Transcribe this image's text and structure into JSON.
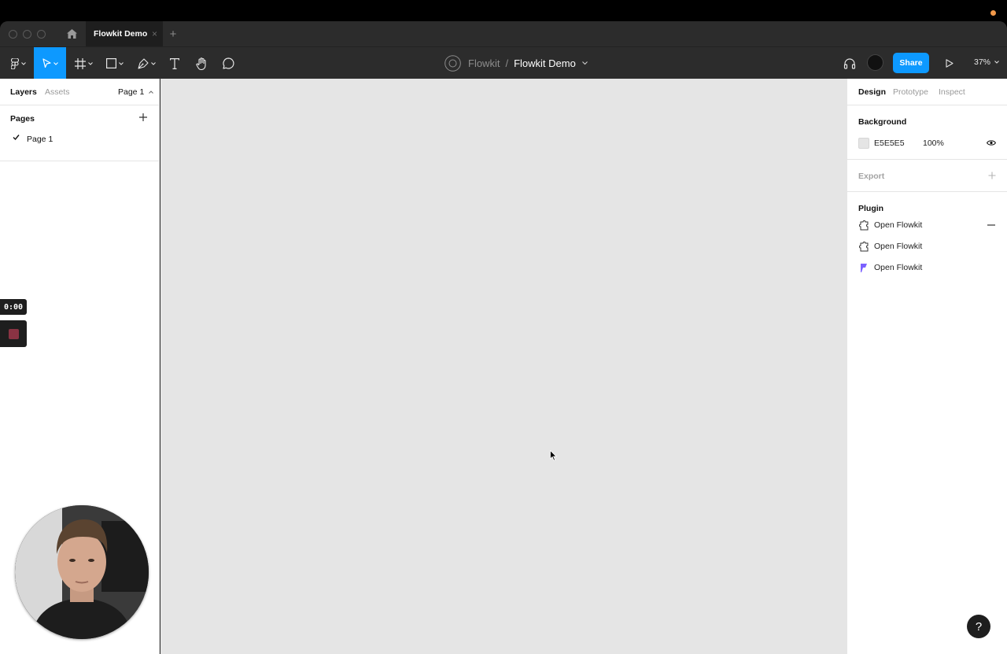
{
  "window": {
    "tab_title": "Flowkit Demo",
    "new_tab": "+",
    "tab_close": "×"
  },
  "toolbar": {
    "team": "Flowkit",
    "separator": "/",
    "file_name": "Flowkit Demo",
    "share_label": "Share",
    "zoom": "37%"
  },
  "left_panel": {
    "tab_layers": "Layers",
    "tab_assets": "Assets",
    "page_selector": "Page 1",
    "pages_label": "Pages",
    "pages": [
      {
        "label": "Page 1",
        "selected": true
      }
    ]
  },
  "recording": {
    "time": "0:00"
  },
  "right_panel": {
    "tabs": [
      "Design",
      "Prototype",
      "Inspect"
    ],
    "background_label": "Background",
    "background_hex": "E5E5E5",
    "background_opacity": "100%",
    "export_label": "Export",
    "plugin_label": "Plugin",
    "plugins": [
      {
        "label": "Open Flowkit",
        "icon": "plugin-icon"
      },
      {
        "label": "Open Flowkit",
        "icon": "plugin-icon"
      },
      {
        "label": "Open Flowkit",
        "icon": "flowkit-logo-icon"
      }
    ]
  },
  "help_label": "?",
  "colors": {
    "accent": "#0d99ff",
    "canvas": "#e5e5e5",
    "toolbar": "#2c2c2c",
    "flowkit_purple": "#7b61ff"
  }
}
